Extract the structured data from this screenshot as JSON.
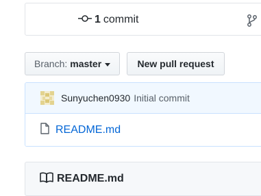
{
  "summary": {
    "commit_count": "1",
    "commit_word": "commit",
    "commit_icon": "git-commit-icon",
    "branch_icon": "git-branch-icon"
  },
  "toolbar": {
    "branch_prefix": "Branch:",
    "branch_name": "master",
    "new_pr_label": "New pull request"
  },
  "latest_commit": {
    "author": "Sunyuchen0930",
    "message": "Initial commit"
  },
  "files": [
    {
      "icon": "file-icon",
      "name": "README.md"
    }
  ],
  "readme": {
    "icon": "book-icon",
    "title": "README.md"
  },
  "colors": {
    "link": "#0366d6",
    "commit_bar_bg": "#f1f8ff",
    "commit_bar_border": "#c8e1ff",
    "text": "#24292e",
    "muted": "#586069"
  }
}
